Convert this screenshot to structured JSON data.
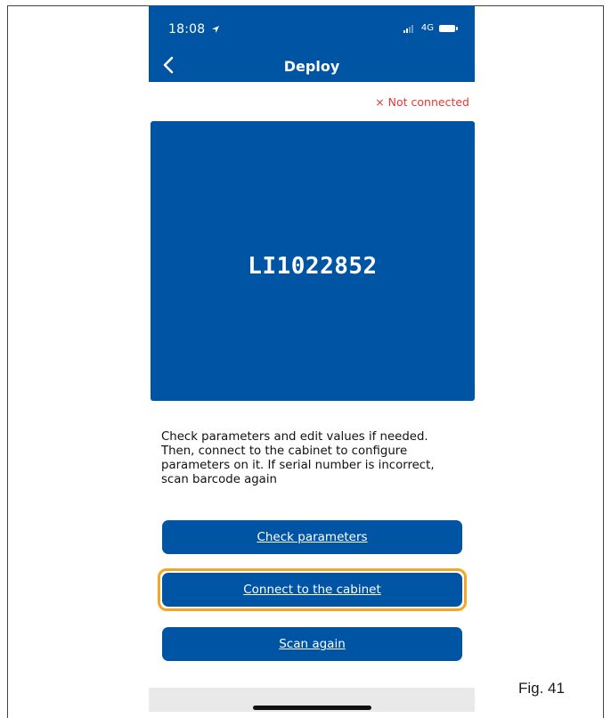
{
  "status_bar": {
    "time": "18:08",
    "location_icon": "location-arrow-icon",
    "network": "4G",
    "signal_icon": "signal-icon",
    "battery_icon": "battery-icon"
  },
  "nav": {
    "back_icon": "chevron-left-icon",
    "title": "Deploy"
  },
  "connection": {
    "status_icon": "close-icon",
    "status_text": "× Not connected",
    "color": "#e53935"
  },
  "device": {
    "serial_number": "LI1022852"
  },
  "instructions": "Check parameters and edit values if needed. Then, connect to the cabinet to configure parameters on it. If serial number is incorrect, scan barcode again",
  "buttons": {
    "check_parameters": "Check parameters",
    "connect_cabinet": "Connect to the cabinet",
    "scan_again": "Scan again"
  },
  "colors": {
    "brand_blue": "#0054a4",
    "highlight": "#f5a623",
    "error": "#e53935"
  },
  "figure_caption": "Fig. 41"
}
